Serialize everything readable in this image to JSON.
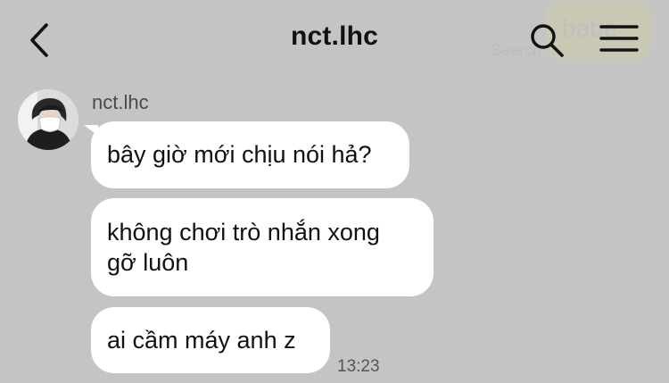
{
  "header": {
    "title": "nct.lhc",
    "ghost_search_text": "Search",
    "ghost_tag_text": "babe"
  },
  "conversation": {
    "sender_name": "nct.lhc",
    "messages": [
      {
        "text": "bây giờ mới chịu nói hả?"
      },
      {
        "text": "không chơi trò nhắn xong\ngỡ luôn"
      },
      {
        "text": "ai cầm máy anh z"
      }
    ],
    "last_time": "13:23"
  },
  "colors": {
    "background": "#c4c4c4",
    "bubble": "#ffffff",
    "text": "#111111",
    "meta_text": "#555555"
  },
  "icons": {
    "back": "chevron-left-icon",
    "search": "search-icon",
    "menu": "hamburger-menu-icon",
    "avatar": "avatar"
  }
}
